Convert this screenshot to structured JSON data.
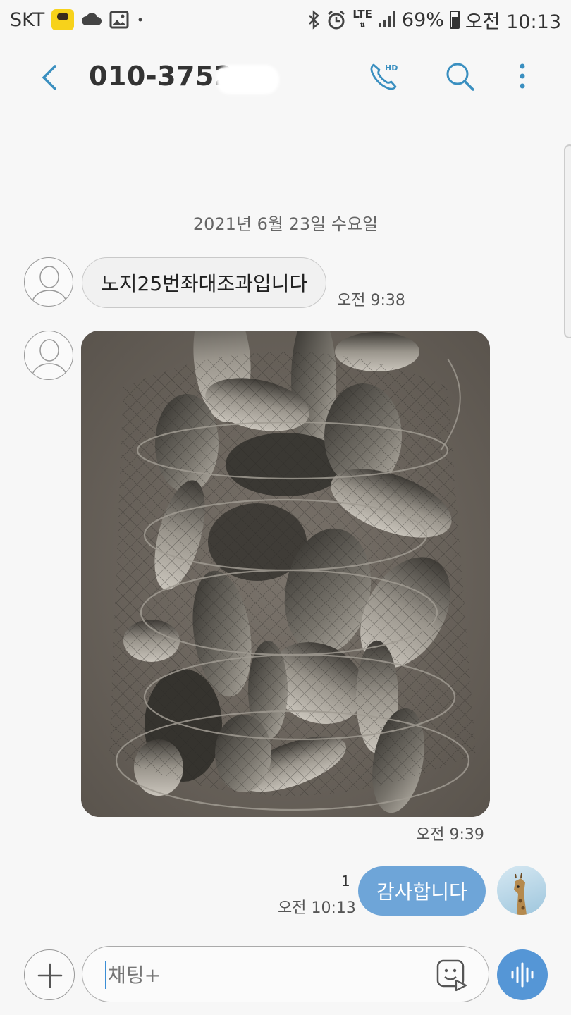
{
  "status_bar": {
    "carrier": "SKT",
    "network": "LTE",
    "battery": "69%",
    "clock": "오전 10:13"
  },
  "header": {
    "title": "010-3752-",
    "icons": [
      "back-icon",
      "hd-call-icon",
      "search-icon",
      "more-vert-icon"
    ]
  },
  "conversation": {
    "date": "2021년 6월 23일 수요일",
    "messages": [
      {
        "direction": "incoming",
        "type": "text",
        "text": "노지25번좌대조과입니다",
        "time": "오전 9:38"
      },
      {
        "direction": "incoming",
        "type": "image",
        "image_icon": "fish-catch-photo",
        "time": "오전 9:39"
      },
      {
        "direction": "outgoing",
        "type": "text",
        "text": "감사합니다",
        "time": "오전 10:13",
        "unread_count": "1"
      }
    ]
  },
  "composer": {
    "placeholder": "채팅+"
  },
  "colors": {
    "accent": "#3b8ed6",
    "outgoing_bubble": "#6ea5d8",
    "incoming_bubble": "#f1f1f1",
    "voice_button": "#5596d6"
  }
}
